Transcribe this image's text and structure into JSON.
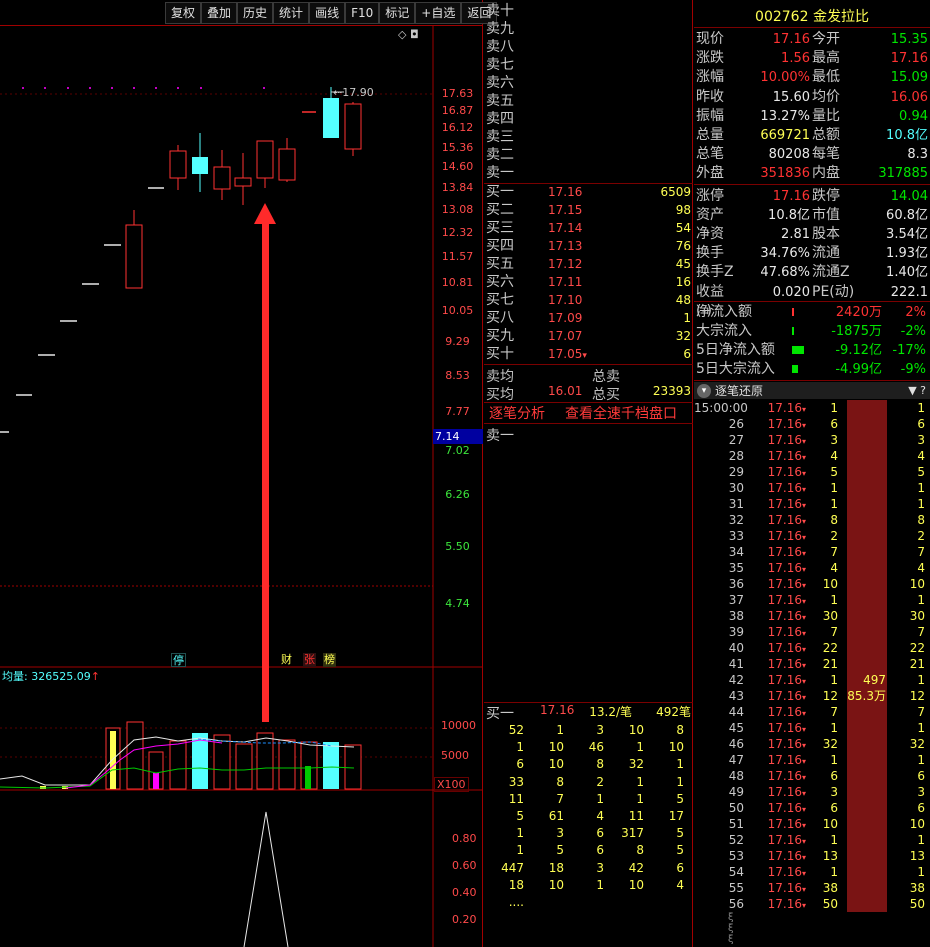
{
  "toolbar": [
    "复权",
    "叠加",
    "历史",
    "统计",
    "画线",
    "F10",
    "标记",
    "+自选",
    "返回"
  ],
  "scale_icons": "◇ ◘",
  "chart": {
    "price_ticks": [
      "17.63",
      "16.87",
      "16.12",
      "15.36",
      "14.60",
      "13.84",
      "13.08",
      "12.32",
      "11.57",
      "10.81",
      "10.05",
      "9.29",
      "8.53",
      "7.77",
      "7.02",
      "6.26",
      "5.50",
      "4.74"
    ],
    "last_price_tag": "7.14",
    "high_label": "17.90",
    "tags": [
      "停",
      "财",
      "张",
      "榜"
    ],
    "vol_avg_label": "均量: 326525.09",
    "vol_ticks": [
      "10000",
      "5000"
    ],
    "vol_unit": "X100",
    "ind_ticks": [
      "0.80",
      "0.60",
      "0.40",
      "0.20"
    ]
  },
  "order_book": {
    "sells": [
      {
        "label": "卖十"
      },
      {
        "label": "卖九"
      },
      {
        "label": "卖八"
      },
      {
        "label": "卖七"
      },
      {
        "label": "卖六"
      },
      {
        "label": "卖五"
      },
      {
        "label": "卖四"
      },
      {
        "label": "卖三"
      },
      {
        "label": "卖二"
      },
      {
        "label": "卖一"
      }
    ],
    "buys": [
      {
        "label": "买一",
        "price": "17.16",
        "qty": "6509"
      },
      {
        "label": "买二",
        "price": "17.15",
        "qty": "98"
      },
      {
        "label": "买三",
        "price": "17.14",
        "qty": "54"
      },
      {
        "label": "买四",
        "price": "17.13",
        "qty": "76"
      },
      {
        "label": "买五",
        "price": "17.12",
        "qty": "45"
      },
      {
        "label": "买六",
        "price": "17.11",
        "qty": "16"
      },
      {
        "label": "买七",
        "price": "17.10",
        "qty": "48"
      },
      {
        "label": "买八",
        "price": "17.09",
        "qty": "1"
      },
      {
        "label": "买九",
        "price": "17.07",
        "qty": "32"
      },
      {
        "label": "买十",
        "price": "17.05",
        "qty": "6",
        "arrow": "▾"
      }
    ],
    "sell_avg": {
      "label": "卖均",
      "total_label": "总卖",
      "price": "",
      "total": ""
    },
    "buy_avg": {
      "label": "买均",
      "price": "16.01",
      "total_label": "总买",
      "total": "23393"
    },
    "tabs": [
      "逐笔分析",
      "查看全速千档盘口"
    ],
    "queue_label": "卖一",
    "queue_header": {
      "label": "买一",
      "price": "17.16",
      "per": "13.2/笔",
      "count": "492笔"
    },
    "queue": [
      [
        "52",
        "1",
        "3",
        "10",
        "8"
      ],
      [
        "1",
        "10",
        "46",
        "1",
        "10"
      ],
      [
        "6",
        "10",
        "8",
        "32",
        "1"
      ],
      [
        "33",
        "8",
        "2",
        "1",
        "1"
      ],
      [
        "11",
        "7",
        "1",
        "1",
        "5"
      ],
      [
        "5",
        "61",
        "4",
        "11",
        "17"
      ],
      [
        "1",
        "3",
        "6",
        "317",
        "5"
      ],
      [
        "1",
        "5",
        "6",
        "8",
        "5"
      ],
      [
        "447",
        "18",
        "3",
        "42",
        "6"
      ],
      [
        "18",
        "10",
        "1",
        "10",
        "4"
      ],
      [
        "....",
        "",
        "",
        "",
        ""
      ]
    ]
  },
  "quote": {
    "code": "002762",
    "name": "金发拉比",
    "rows": [
      {
        "l1": "现价",
        "v1": "17.16",
        "c1": "red",
        "l2": "今开",
        "v2": "15.35",
        "c2": "green"
      },
      {
        "l1": "涨跌",
        "v1": "1.56",
        "c1": "red",
        "l2": "最高",
        "v2": "17.16",
        "c2": "red"
      },
      {
        "l1": "涨幅",
        "v1": "10.00%",
        "c1": "red",
        "l2": "最低",
        "v2": "15.09",
        "c2": "green"
      },
      {
        "l1": "昨收",
        "v1": "15.60",
        "c1": "white",
        "l2": "均价",
        "v2": "16.06",
        "c2": "red"
      },
      {
        "l1": "振幅",
        "v1": "13.27%",
        "c1": "white",
        "l2": "量比",
        "v2": "0.94",
        "c2": "green"
      },
      {
        "l1": "总量",
        "v1": "669721",
        "c1": "yellow",
        "l2": "总额",
        "v2": "10.8亿",
        "c2": "cyan"
      },
      {
        "l1": "总笔",
        "v1": "80208",
        "c1": "white",
        "l2": "每笔",
        "v2": "8.3",
        "c2": "white"
      },
      {
        "l1": "外盘",
        "v1": "351836",
        "c1": "red",
        "l2": "内盘",
        "v2": "317885",
        "c2": "green"
      },
      {
        "l1": "涨停",
        "v1": "17.16",
        "c1": "red",
        "l2": "跌停",
        "v2": "14.04",
        "c2": "green"
      },
      {
        "l1": "资产",
        "v1": "10.8亿",
        "c1": "white",
        "l2": "市值",
        "v2": "60.8亿",
        "c2": "white"
      },
      {
        "l1": "净资",
        "v1": "2.81",
        "c1": "white",
        "l2": "股本",
        "v2": "3.54亿",
        "c2": "white"
      },
      {
        "l1": "换手",
        "v1": "34.76%",
        "c1": "white",
        "l2": "流通",
        "v2": "1.93亿",
        "c2": "white"
      },
      {
        "l1": "换手Z",
        "v1": "47.68%",
        "c1": "white",
        "l2": "流通Z",
        "v2": "1.40亿",
        "c2": "white"
      },
      {
        "l1": "收益(-)",
        "v1": "0.020",
        "c1": "white",
        "l2": "PE(动)",
        "v2": "222.1",
        "c2": "white"
      }
    ],
    "flows": [
      {
        "label": "净流入额",
        "value": "2420万",
        "pct": "2%",
        "color": "red"
      },
      {
        "label": "大宗流入",
        "value": "-1875万",
        "pct": "-2%",
        "color": "green"
      },
      {
        "label": "5日净流入额",
        "value": "-9.12亿",
        "pct": "-17%",
        "color": "green"
      },
      {
        "label": "5日大宗流入",
        "value": "-4.99亿",
        "pct": "-9%",
        "color": "green"
      }
    ]
  },
  "ticks": {
    "title": "逐笔还原",
    "header_icons": "▼ ?",
    "bar_label_1": "497",
    "bar_label_2": "85.3万",
    "rows": [
      [
        "15:00:00",
        "17.16",
        "1",
        "",
        "1"
      ],
      [
        "26",
        "17.16",
        "6",
        "",
        "6"
      ],
      [
        "27",
        "17.16",
        "3",
        "",
        "3"
      ],
      [
        "28",
        "17.16",
        "4",
        "",
        "4"
      ],
      [
        "29",
        "17.16",
        "5",
        "",
        "5"
      ],
      [
        "30",
        "17.16",
        "1",
        "",
        "1"
      ],
      [
        "31",
        "17.16",
        "1",
        "",
        "1"
      ],
      [
        "32",
        "17.16",
        "8",
        "",
        "8"
      ],
      [
        "33",
        "17.16",
        "2",
        "",
        "2"
      ],
      [
        "34",
        "17.16",
        "7",
        "",
        "7"
      ],
      [
        "35",
        "17.16",
        "4",
        "",
        "4"
      ],
      [
        "36",
        "17.16",
        "10",
        "",
        "10"
      ],
      [
        "37",
        "17.16",
        "1",
        "",
        "1"
      ],
      [
        "38",
        "17.16",
        "30",
        "",
        "30"
      ],
      [
        "39",
        "17.16",
        "7",
        "",
        "7"
      ],
      [
        "40",
        "17.16",
        "22",
        "",
        "22"
      ],
      [
        "41",
        "17.16",
        "21",
        "",
        "21"
      ],
      [
        "42",
        "17.16",
        "1",
        "497",
        "1"
      ],
      [
        "43",
        "17.16",
        "12",
        "85.3万",
        "12"
      ],
      [
        "44",
        "17.16",
        "7",
        "",
        "7"
      ],
      [
        "45",
        "17.16",
        "1",
        "",
        "1"
      ],
      [
        "46",
        "17.16",
        "32",
        "",
        "32"
      ],
      [
        "47",
        "17.16",
        "1",
        "",
        "1"
      ],
      [
        "48",
        "17.16",
        "6",
        "",
        "6"
      ],
      [
        "49",
        "17.16",
        "3",
        "",
        "3"
      ],
      [
        "50",
        "17.16",
        "6",
        "",
        "6"
      ],
      [
        "51",
        "17.16",
        "10",
        "",
        "10"
      ],
      [
        "52",
        "17.16",
        "1",
        "",
        "1"
      ],
      [
        "53",
        "17.16",
        "13",
        "",
        "13"
      ],
      [
        "54",
        "17.16",
        "1",
        "",
        "1"
      ],
      [
        "55",
        "17.16",
        "38",
        "",
        "38"
      ],
      [
        "56",
        "17.16",
        "50",
        "",
        "50"
      ]
    ]
  }
}
